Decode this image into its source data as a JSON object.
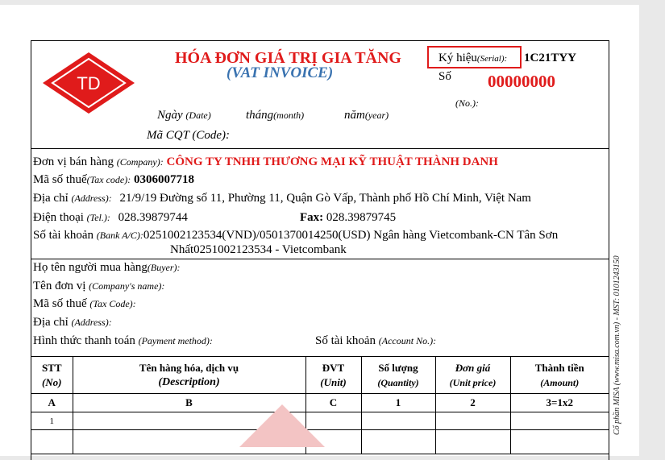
{
  "logo": {
    "text": "TD",
    "color": "#e01b1b"
  },
  "header": {
    "title_vn": "HÓA ĐƠN GIÁ TRỊ GIA TĂNG",
    "title_en": "(VAT INVOICE)",
    "serial_label": "Ký hiệu",
    "serial_label_en": "(Serial):",
    "serial_value": "1C21TYY",
    "number_label": "Số",
    "number_value": "00000000",
    "number_label_en": "(No.):",
    "date_label": "Ngày",
    "date_en": "(Date)",
    "month_label": "tháng",
    "month_en": "(month)",
    "year_label": "năm",
    "year_en": "(year)",
    "cqt_label": "Mã CQT (Code):"
  },
  "seller": {
    "company_label": "Đơn vị bán hàng",
    "company_label_en": "(Company):",
    "company_name": "CÔNG TY TNHH THƯƠNG MẠI KỸ THUẬT THÀNH DANH",
    "tax_label": "Mã số thuế",
    "tax_label_en": "(Tax code):",
    "tax_code": "0306007718",
    "address_label": "Địa chỉ",
    "address_label_en": "(Address):",
    "address": "21/9/19 Đường số 11, Phường 11, Quận Gò Vấp, Thành phố Hồ Chí Minh, Việt Nam",
    "phone_label": "Điện thoại",
    "phone_label_en": "(Tel.):",
    "phone": "028.39879744",
    "fax_label": "Fax:",
    "fax": "028.39879745",
    "bank_label": "Số tài khoản",
    "bank_label_en": "(Bank A/C):",
    "bank_line1": "0251002123534(VND)/0501370014250(USD) Ngân hàng Vietcombank-CN Tân Sơn",
    "bank_line2": "Nhất0251002123534 - Vietcombank"
  },
  "buyer": {
    "buyer_label": "Họ tên người mua hàng",
    "buyer_label_en": "(Buyer):",
    "company_label": "Tên đơn vị",
    "company_label_en": "(Company's name):",
    "tax_label": "Mã số thuế",
    "tax_label_en": "(Tax Code):",
    "address_label": "Địa chỉ",
    "address_label_en": "(Address):",
    "payment_label": "Hình thức thanh toán",
    "payment_label_en": "(Payment method):",
    "account_label": "Số tài khoản",
    "account_label_en": "(Account No.):"
  },
  "table": {
    "columns": [
      {
        "vn": "STT",
        "en": "(No)",
        "code": "A"
      },
      {
        "vn": "Tên hàng hóa, dịch vụ",
        "en": "(Description)",
        "code": "B"
      },
      {
        "vn": "ĐVT",
        "en": "(Unit)",
        "code": "C"
      },
      {
        "vn": "Số lượng",
        "en": "(Quantity)",
        "code": "1"
      },
      {
        "vn": "Đơn giá",
        "en": "(Unit price)",
        "code": "2"
      },
      {
        "vn": "Thành tiền",
        "en": "(Amount)",
        "code": "3=1x2"
      }
    ],
    "rows": [
      {
        "no": "1"
      }
    ]
  },
  "side_note": "Cổ phần MISA (www.misa.com.vn) - MST: 0101243150"
}
